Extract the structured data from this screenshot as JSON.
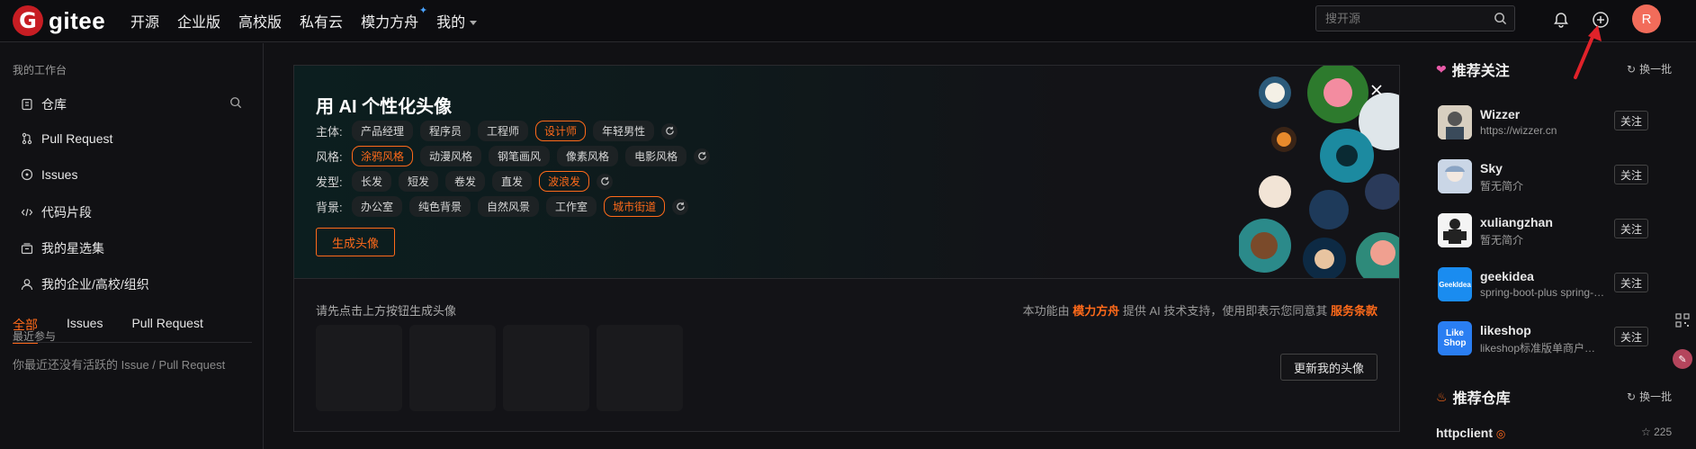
{
  "brand": {
    "mark": "G",
    "name": "gitee",
    "accent": "#ff6a1a",
    "logo_color": "#c71d23"
  },
  "nav": [
    {
      "label": "开源"
    },
    {
      "label": "企业版"
    },
    {
      "label": "高校版"
    },
    {
      "label": "私有云"
    },
    {
      "label": "模力方舟"
    },
    {
      "label": "我的"
    }
  ],
  "search": {
    "placeholder": "搜开源"
  },
  "user_avatar": "R",
  "sidebar": {
    "workspace_title": "我的工作台",
    "items": [
      {
        "label": "仓库",
        "icon": "repo-icon"
      },
      {
        "label": "Pull Request",
        "icon": "pull-request-icon"
      },
      {
        "label": "Issues",
        "icon": "issues-icon"
      },
      {
        "label": "代码片段",
        "icon": "code-snippet-icon"
      },
      {
        "label": "我的星选集",
        "icon": "collection-icon"
      },
      {
        "label": "我的企业/高校/组织",
        "icon": "organization-icon"
      }
    ],
    "recent_title": "最近参与",
    "tabs": [
      {
        "label": "全部"
      },
      {
        "label": "Issues"
      },
      {
        "label": "Pull Request"
      }
    ],
    "empty_text": "你最近还没有活跃的 Issue / Pull Request"
  },
  "ai_card": {
    "title": "用 AI 个性化头像",
    "rows": [
      {
        "label": "主体:",
        "options": [
          "产品经理",
          "程序员",
          "工程师",
          "设计师",
          "年轻男性"
        ],
        "selected": "设计师"
      },
      {
        "label": "风格:",
        "options": [
          "涂鸦风格",
          "动漫风格",
          "钢笔画风",
          "像素风格",
          "电影风格"
        ],
        "selected": "涂鸦风格"
      },
      {
        "label": "发型:",
        "options": [
          "长发",
          "短发",
          "卷发",
          "直发",
          "波浪发"
        ],
        "selected": "波浪发"
      },
      {
        "label": "背景:",
        "options": [
          "办公室",
          "纯色背景",
          "自然风景",
          "工作室",
          "城市街道"
        ],
        "selected": "城市街道"
      }
    ],
    "generate_label": "生成头像",
    "hint": "请先点击上方按钮生成头像",
    "policy_prefix": "本功能由 ",
    "policy_brand": "模力方舟",
    "policy_middle": " 提供 AI 技术支持，使用即表示您同意其 ",
    "policy_link": "服务条款",
    "update_label": "更新我的头像"
  },
  "recommend_users": {
    "title": "推荐关注",
    "swap_label": "换一批",
    "follow_label": "关注",
    "users": [
      {
        "name": "Wizzer",
        "desc": "https://wizzer.cn"
      },
      {
        "name": "Sky",
        "desc": "暂无简介"
      },
      {
        "name": "xuliangzhan",
        "desc": "暂无简介"
      },
      {
        "name": "geekidea",
        "desc": "spring-boot-plus spring-cloud-plus",
        "avatar_text": "GeekIdea"
      },
      {
        "name": "likeshop",
        "desc": "likeshop标准版单商户源码，likeshop商城",
        "avatar_text": "Like Shop"
      }
    ]
  },
  "recommend_repos": {
    "title": "推荐仓库",
    "swap_label": "换一批",
    "first_repo": "httpclient",
    "first_repo_stars": "225"
  }
}
